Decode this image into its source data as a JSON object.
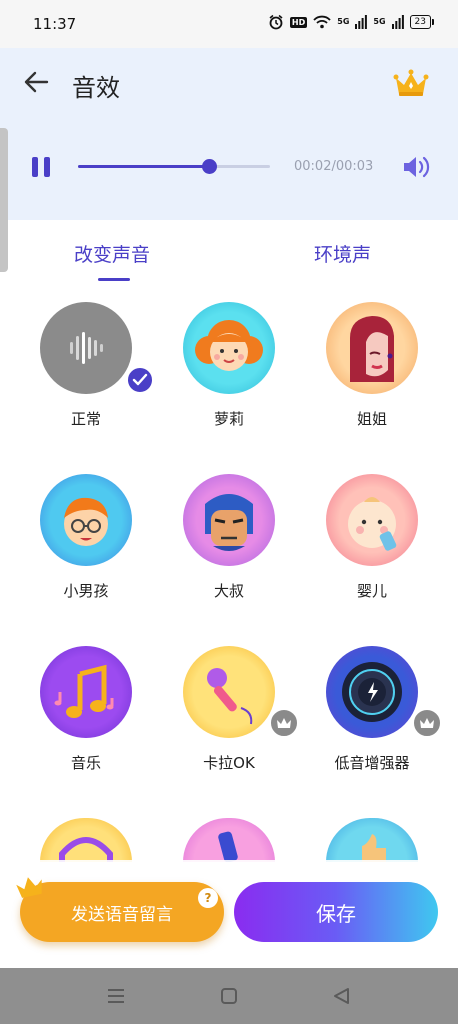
{
  "status_bar": {
    "time": "11:37",
    "hd_label": "HD",
    "net1": "5G",
    "net2": "5G",
    "battery": "23"
  },
  "header": {
    "title": "音效",
    "back_icon": "arrow-left-icon",
    "vip_icon": "crown-icon"
  },
  "player": {
    "state": "playing",
    "progress": 0.69,
    "time_readout": "00:02/00:03"
  },
  "tabs": [
    {
      "label": "改变声音",
      "selected": true
    },
    {
      "label": "环境声",
      "selected": false
    }
  ],
  "effects": [
    {
      "label": "正常",
      "selected": true,
      "vip": false,
      "icon": "soundwave-icon"
    },
    {
      "label": "萝莉",
      "selected": false,
      "vip": false,
      "icon": "girl-icon"
    },
    {
      "label": "姐姐",
      "selected": false,
      "vip": false,
      "icon": "woman-icon"
    },
    {
      "label": "小男孩",
      "selected": false,
      "vip": false,
      "icon": "boy-icon"
    },
    {
      "label": "大叔",
      "selected": false,
      "vip": false,
      "icon": "uncle-icon"
    },
    {
      "label": "婴儿",
      "selected": false,
      "vip": false,
      "icon": "baby-icon"
    },
    {
      "label": "音乐",
      "selected": false,
      "vip": false,
      "icon": "music-note-icon"
    },
    {
      "label": "卡拉OK",
      "selected": false,
      "vip": true,
      "icon": "microphone-icon"
    },
    {
      "label": "低音增强器",
      "selected": false,
      "vip": true,
      "icon": "bass-knob-icon"
    }
  ],
  "actions": {
    "voice_message": "发送语音留言",
    "help": "?",
    "save": "保存"
  },
  "colors": {
    "accent": "#4a3fc7",
    "header_bg": "#eaf1fc",
    "voice_button": "#f4a623",
    "save_gradient_start": "#8a2cf0",
    "save_gradient_end": "#3fc8f0",
    "nav_bar": "#8f8f8f"
  }
}
